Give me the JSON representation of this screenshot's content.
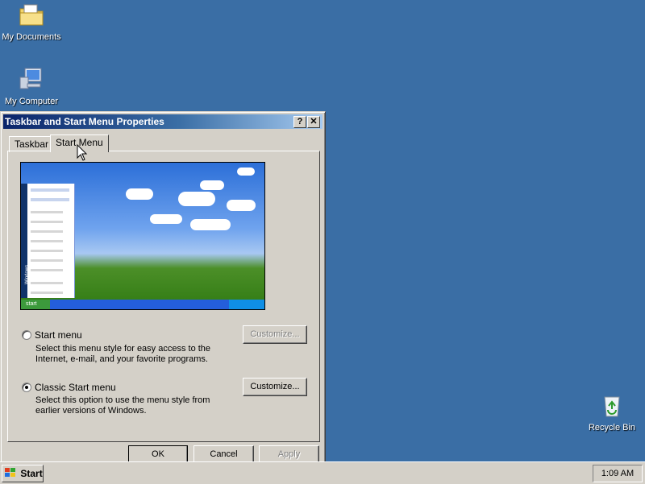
{
  "desktop": {
    "icons": [
      {
        "label": "My Documents",
        "icon": "folder-documents-icon"
      },
      {
        "label": "My Computer",
        "icon": "computer-icon"
      },
      {
        "label": "Recycle Bin",
        "icon": "recycle-bin-icon"
      }
    ],
    "background_color": "#3a6ea5"
  },
  "dialog": {
    "title": "Taskbar and Start Menu Properties",
    "help_button": "?",
    "close_button": "✕",
    "tabs": [
      {
        "label": "Taskbar",
        "active": false
      },
      {
        "label": "Start Menu",
        "active": true
      }
    ],
    "options": [
      {
        "label": "Start menu",
        "description": [
          "Select this menu style for easy access to the",
          "Internet, e-mail, and your favorite programs."
        ],
        "selected": false,
        "customize_label": "Customize...",
        "customize_enabled": false
      },
      {
        "label": "Classic Start menu",
        "description": [
          "Select this option to use the menu style from",
          "earlier versions of Windows."
        ],
        "selected": true,
        "customize_label": "Customize...",
        "customize_enabled": true
      }
    ],
    "buttons": {
      "ok": "OK",
      "cancel": "Cancel",
      "apply": "Apply"
    },
    "preview": {
      "start_label": "start",
      "side_label": "Windows"
    }
  },
  "taskbar": {
    "start_label": "Start",
    "clock": "1:09 AM"
  }
}
